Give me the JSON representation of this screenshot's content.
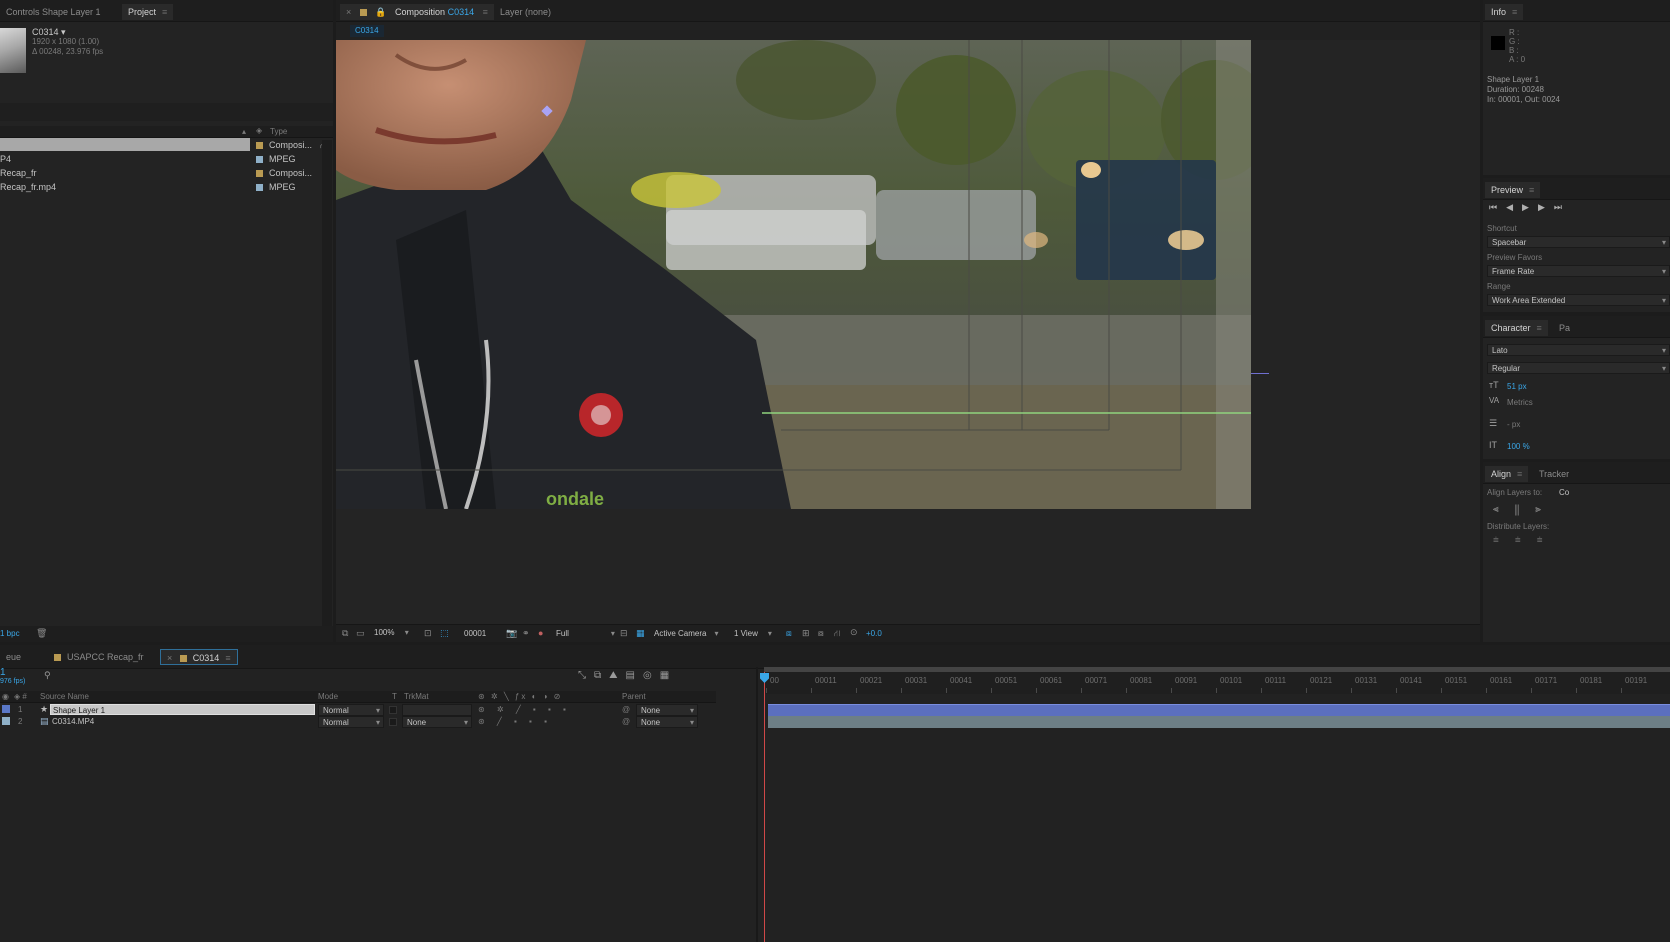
{
  "project_panel": {
    "tabs": [
      {
        "label": "Controls Shape Layer 1"
      },
      {
        "label": "Project"
      }
    ],
    "footage": {
      "name": "C0314 ▾",
      "resolution": "1920 x 1080 (1.00)",
      "duration": "Δ 00248, 23.976 fps"
    },
    "column_type": "Type",
    "items": [
      {
        "name": "",
        "type": "Composi...",
        "color": "#b99a52",
        "selected": true
      },
      {
        "name": "P4",
        "type": "MPEG",
        "color": "#8fb0c8",
        "selected": false
      },
      {
        "name": "Recap_fr",
        "type": "Composi...",
        "color": "#b99a52",
        "selected": false
      },
      {
        "name": "Recap_fr.mp4",
        "type": "MPEG",
        "color": "#8fb0c8",
        "selected": false
      }
    ],
    "footer_label": "1 bpc"
  },
  "comp_panel": {
    "tab_composition_prefix": "Composition",
    "tab_composition_name": "C0314",
    "tab_layer": "Layer (none)",
    "sub_tab": "C0314",
    "toolbar": {
      "zoom": "100%",
      "timecode": "00001",
      "resolution": "Full",
      "camera": "Active Camera",
      "view": "1 View",
      "exposure": "+0.0"
    }
  },
  "info_panel": {
    "title": "Info",
    "r": "R :",
    "g": "G :",
    "b": "B :",
    "a": "A : 0",
    "layer_name": "Shape Layer 1",
    "duration": "Duration: 00248",
    "in_out": "In: 00001, Out: 0024"
  },
  "preview_panel": {
    "title": "Preview",
    "shortcut_label": "Shortcut",
    "shortcut_value": "Spacebar",
    "favors_label": "Preview Favors",
    "favors_value": "Frame Rate",
    "range_label": "Range",
    "range_value": "Work Area Extended"
  },
  "character_panel": {
    "title": "Character",
    "tab2": "Pa",
    "font": "Lato",
    "style": "Regular",
    "size": "51 px",
    "kerning": "Metrics",
    "leading": "- px",
    "scale": "100 %"
  },
  "align_panel": {
    "title": "Align",
    "tab2": "Tracker",
    "align_to_label": "Align Layers to:",
    "align_to_value": "Co",
    "distribute_label": "Distribute Layers:"
  },
  "timeline": {
    "tabs": [
      {
        "label": "eue"
      },
      {
        "label": "USAPCC Recap_fr"
      },
      {
        "label": "C0314"
      }
    ],
    "timecode": "1",
    "fps": "976 fps)",
    "columns": {
      "source_name": "Source Name",
      "mode": "Mode",
      "t": "T",
      "trkmat": "TrkMat",
      "parent": "Parent"
    },
    "layers": [
      {
        "num": "1",
        "name": "Shape Layer 1",
        "mode": "Normal",
        "trkmat": "",
        "parent": "None",
        "color": "#5a78c8"
      },
      {
        "num": "2",
        "name": "C0314.MP4",
        "mode": "Normal",
        "trkmat": "None",
        "parent": "None",
        "color": "#8fb0c8"
      }
    ],
    "ruler": [
      "00",
      "00011",
      "00021",
      "00031",
      "00041",
      "00051",
      "00061",
      "00071",
      "00081",
      "00091",
      "00101",
      "00111",
      "00121",
      "00131",
      "00141",
      "00151",
      "00161",
      "00171",
      "00181",
      "00191"
    ]
  }
}
